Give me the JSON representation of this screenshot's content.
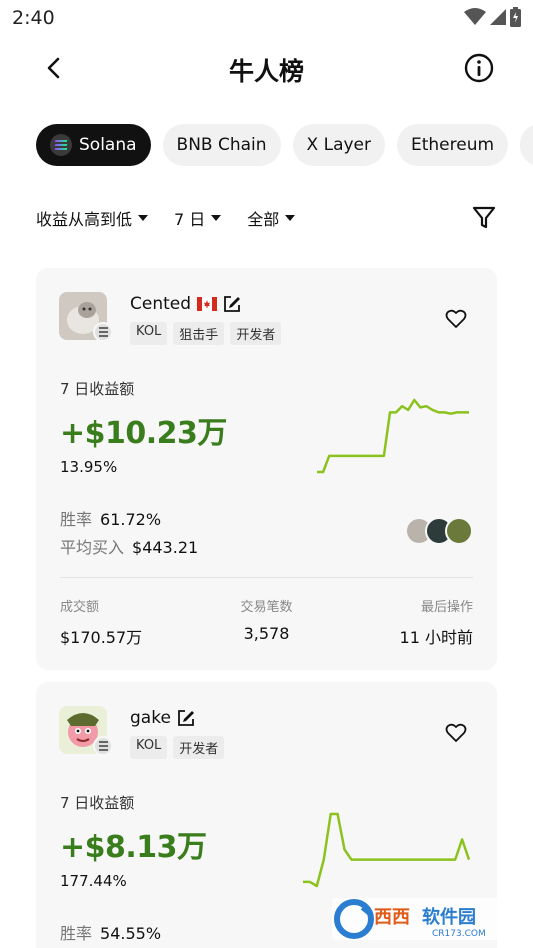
{
  "status_bar": {
    "time": "2:40"
  },
  "nav": {
    "title": "牛人榜"
  },
  "chains": [
    {
      "label": "Solana",
      "active": true
    },
    {
      "label": "BNB Chain",
      "active": false
    },
    {
      "label": "X Layer",
      "active": false
    },
    {
      "label": "Ethereum",
      "active": false
    }
  ],
  "filters": {
    "sort": "收益从高到低",
    "period": "7 日",
    "scope": "全部"
  },
  "cards": [
    {
      "name": "Cented",
      "flag": "🇨🇦",
      "tags": [
        "KOL",
        "狙击手",
        "开发者"
      ],
      "pnl_label": "7 日收益额",
      "pnl_value": "+$10.23万",
      "pnl_pct": "13.95%",
      "win_label": "胜率",
      "win_value": "61.72%",
      "avg_label": "平均买入",
      "avg_value": "$443.21",
      "volume_label": "成交额",
      "volume_value": "$170.57万",
      "trades_label": "交易笔数",
      "trades_value": "3,578",
      "last_label": "最后操作",
      "last_value": "11 小时前",
      "sparkline": [
        2,
        2,
        15,
        15,
        15,
        15,
        15,
        15,
        15,
        15,
        15,
        15,
        50,
        50,
        55,
        52,
        60,
        54,
        55,
        52,
        50,
        50,
        49,
        50,
        50,
        50
      ],
      "spark_color": "#8bc21e"
    },
    {
      "name": "gake",
      "tags": [
        "KOL",
        "开发者"
      ],
      "pnl_label": "7 日收益额",
      "pnl_value": "+$8.13万",
      "pnl_pct": "177.44%",
      "win_label": "胜率",
      "win_value": "54.55%",
      "sparkline": [
        8,
        8,
        4,
        30,
        75,
        75,
        40,
        30,
        30,
        30,
        30,
        30,
        30,
        30,
        30,
        30,
        30,
        30,
        30,
        30,
        30,
        30,
        30,
        50,
        30
      ],
      "spark_color": "#8bc21e"
    }
  ],
  "watermark": {
    "brand": "西西软件园",
    "url": "CR173.COM"
  }
}
